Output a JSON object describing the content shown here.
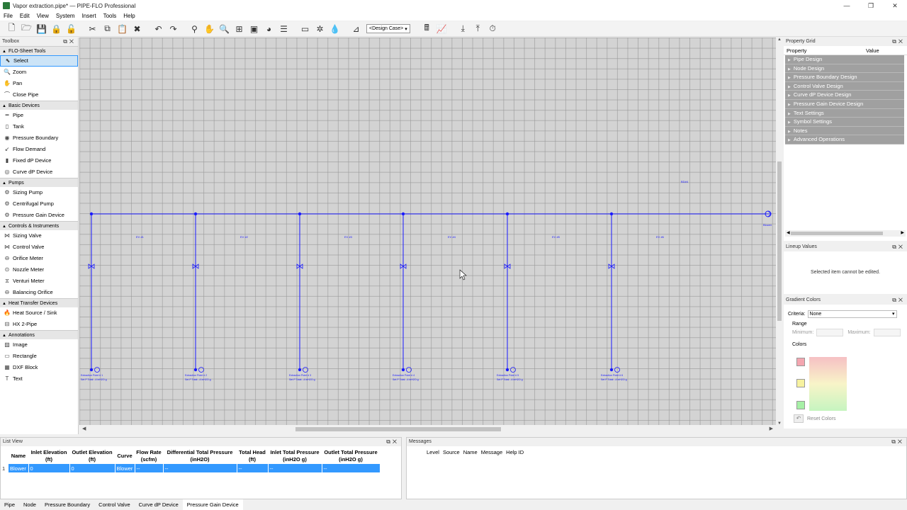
{
  "window": {
    "title": "Vapor extraction.pipe* — PIPE-FLO Professional",
    "controls": [
      "—",
      "❐",
      "✕"
    ]
  },
  "menu": [
    "File",
    "Edit",
    "View",
    "System",
    "Insert",
    "Tools",
    "Help"
  ],
  "toolbar": {
    "design_case": "<Design Case>"
  },
  "toolbox": {
    "title": "Toolbox",
    "groups": [
      {
        "label": "FLO-Sheet Tools",
        "items": [
          "Select",
          "Zoom",
          "Pan",
          "Close Pipe"
        ]
      },
      {
        "label": "Basic Devices",
        "items": [
          "Pipe",
          "Tank",
          "Pressure Boundary",
          "Flow Demand",
          "Fixed dP Device",
          "Curve dP Device"
        ]
      },
      {
        "label": "Pumps",
        "items": [
          "Sizing Pump",
          "Centrifugal Pump",
          "Pressure Gain Device"
        ]
      },
      {
        "label": "Controls & Instruments",
        "items": [
          "Sizing Valve",
          "Control Valve",
          "Orifice Meter",
          "Nozzle Meter",
          "Venturi Meter",
          "Balancing Orifice"
        ]
      },
      {
        "label": "Heat Transfer Devices",
        "items": [
          "Heat Source / Sink",
          "HX 2-Pipe"
        ]
      },
      {
        "label": "Annotations",
        "items": [
          "Image",
          "Rectangle",
          "DXF Block",
          "Text"
        ]
      }
    ]
  },
  "canvas": {
    "header_label": "Blower",
    "top_label": "BD#4",
    "pipe_labels": [
      "EV #1",
      "EV #2",
      "EV #3",
      "EV #4",
      "EV #5",
      "EV #6"
    ],
    "point_labels": [
      "Extraction Point # 1",
      "Extraction Point # 2",
      "Extraction Point # 3",
      "Extraction Point # 4",
      "Extraction Point # 5",
      "Extraction Point # 6"
    ],
    "point_sub": "Set P Total: -4 inH2O g"
  },
  "property_grid": {
    "title": "Property Grid",
    "col_property": "Property",
    "col_value": "Value",
    "rows": [
      "Pipe Design",
      "Node Design",
      "Pressure Boundary Design",
      "Control Valve Design",
      "Curve dP Device Design",
      "Pressure Gain Device Design",
      "Text Settings",
      "Symbol Settings",
      "Notes",
      "Advanced Operations"
    ]
  },
  "lineup": {
    "title": "Lineup Values",
    "message": "Selected item cannot be edited."
  },
  "gradient": {
    "title": "Gradient Colors",
    "criteria_label": "Criteria:",
    "criteria_value": "None",
    "range_label": "Range",
    "min_label": "Minimum:",
    "max_label": "Maximum:",
    "colors_label": "Colors",
    "reset_label": "Reset Colors",
    "swatches": [
      "#f4a6b0",
      "#f7f2a0",
      "#a6f0a6"
    ]
  },
  "listview": {
    "title": "List View",
    "columns": [
      "Name",
      "Inlet Elevation (ft)",
      "Outlet Elevation (ft)",
      "Curve",
      "Flow Rate (scfm)",
      "Differential Total Pressure (inH2O)",
      "Total Head (ft)",
      "Inlet Total Pressure (inH2O g)",
      "Outlet Total Pressure (inH2O g)"
    ],
    "rows": [
      [
        "Blower",
        "0",
        "0",
        "Blower",
        "--",
        "--",
        "--",
        "--",
        "--"
      ]
    ]
  },
  "bottom_tabs": [
    "Pipe",
    "Node",
    "Pressure Boundary",
    "Control Valve",
    "Curve dP Device",
    "Pressure Gain Device"
  ],
  "messages": {
    "title": "Messages",
    "columns": [
      "Level",
      "Source",
      "Name",
      "Message",
      "Help ID"
    ]
  }
}
